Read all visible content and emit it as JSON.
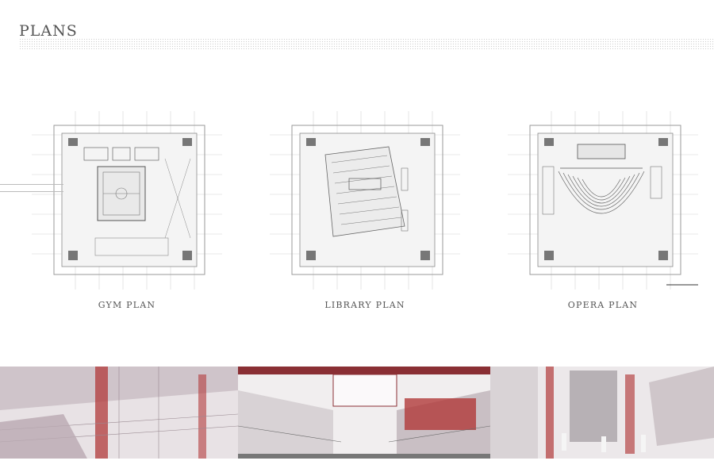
{
  "page": {
    "title": "PLANS"
  },
  "plans": [
    {
      "label": "GYM PLAN"
    },
    {
      "label": "LIBRARY PLAN"
    },
    {
      "label": "OPERA PLAN"
    }
  ],
  "colors": {
    "accent_red": "#b23a3a",
    "drawing_line": "#8f8f8f",
    "grid_line": "#cfcfcf"
  },
  "icons": [
    "gym-plan-drawing",
    "library-plan-drawing",
    "opera-plan-drawing",
    "interior-render"
  ]
}
